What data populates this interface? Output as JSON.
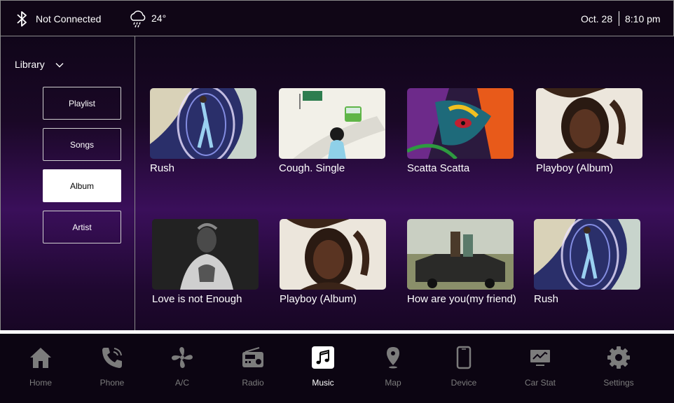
{
  "status": {
    "connection": "Not Connected",
    "temperature": "24°",
    "date": "Oct. 28",
    "time": "8:10 pm",
    "icons": [
      "bluetooth-icon",
      "rain-cloud-icon"
    ]
  },
  "sidebar": {
    "library_label": "Library",
    "items": [
      {
        "label": "Playlist",
        "active": false
      },
      {
        "label": "Songs",
        "active": false
      },
      {
        "label": "Album",
        "active": true
      },
      {
        "label": "Artist",
        "active": false
      }
    ]
  },
  "albums": [
    {
      "title": "Rush"
    },
    {
      "title": "Cough. Single"
    },
    {
      "title": "Scatta Scatta"
    },
    {
      "title": "Playboy (Album)"
    },
    {
      "title": "Love is not Enough"
    },
    {
      "title": "Playboy (Album)"
    },
    {
      "title": "How are you(my friend)"
    },
    {
      "title": "Rush"
    }
  ],
  "nav": {
    "items": [
      {
        "label": "Home",
        "icon": "home-icon"
      },
      {
        "label": "Phone",
        "icon": "phone-icon"
      },
      {
        "label": "A/C",
        "icon": "fan-icon"
      },
      {
        "label": "Radio",
        "icon": "radio-icon"
      },
      {
        "label": "Music",
        "icon": "music-note-icon",
        "active": true
      },
      {
        "label": "Map",
        "icon": "map-pin-icon"
      },
      {
        "label": "Device",
        "icon": "smartphone-icon"
      },
      {
        "label": "Car Stat",
        "icon": "car-stats-icon"
      },
      {
        "label": "Settings",
        "icon": "gear-icon"
      }
    ]
  },
  "colors": {
    "background_top": "#0c0414",
    "background_mid": "#3a0f5a",
    "nav_inactive": "#7c7c7c",
    "nav_active": "#ffffff"
  }
}
